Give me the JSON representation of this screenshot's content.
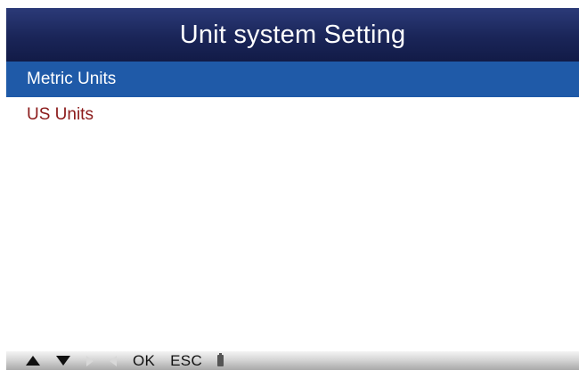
{
  "header": {
    "title": "Unit system Setting"
  },
  "menu": {
    "items": [
      {
        "label": "Metric Units",
        "selected": true
      },
      {
        "label": "US Units",
        "selected": false
      }
    ]
  },
  "footer": {
    "keys": [
      {
        "icon": "arrow-up-icon"
      },
      {
        "icon": "arrow-down-icon"
      },
      {
        "icon": "arrow-right-icon",
        "enabled": false
      },
      {
        "icon": "arrow-left-icon",
        "enabled": false
      },
      {
        "label": "OK"
      },
      {
        "label": "ESC"
      },
      {
        "icon": "battery-icon"
      }
    ]
  },
  "colors": {
    "title_bar": "#1a2558",
    "selected_row": "#1f5aa8",
    "item_text": "#8b1a1a",
    "footer_bar": "#c8c8c8"
  }
}
